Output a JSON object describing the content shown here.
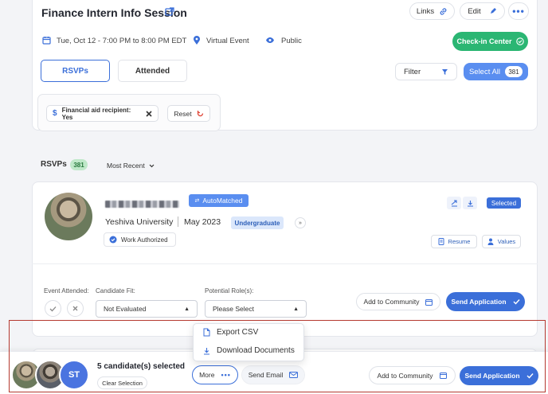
{
  "event": {
    "title": "Finance Intern Info Session",
    "date": "Tue, Oct 12 - 7:00 PM to 8:00 PM EDT",
    "location": "Virtual Event",
    "visibility": "Public",
    "links_label": "Links",
    "edit_label": "Edit",
    "checkin_label": "Check-in Center"
  },
  "tabs": {
    "rsvps": "RSVPs",
    "attended": "Attended"
  },
  "toolbar": {
    "filter_label": "Filter",
    "select_all_label": "Select All",
    "select_all_count": "381"
  },
  "filters": {
    "chip_label": "Financial aid recipient: Yes",
    "reset_label": "Reset"
  },
  "rsvps_section": {
    "title": "RSVPs",
    "count": "381",
    "sort_label": "Most Recent"
  },
  "candidate": {
    "match_badge": "AutoMatched",
    "school": "Yeshiva University",
    "grad_date": "May 2023",
    "level": "Undergraduate",
    "work_auth": "Work Authorized",
    "selected_label": "Selected",
    "resume_label": "Resume",
    "values_label": "Values",
    "event_attended_label": "Event Attended:",
    "fit_label": "Candidate Fit:",
    "fit_value": "Not Evaluated",
    "role_label": "Potential Role(s):",
    "role_placeholder": "Please Select",
    "add_community_label": "Add to Community",
    "send_application_label": "Send Application"
  },
  "dropdown": {
    "export_csv": "Export CSV",
    "download_documents": "Download Documents"
  },
  "bottom_bar": {
    "avatar_initials": "ST",
    "selected_text": "5 candidate(s) selected",
    "clear_label": "Clear Selection",
    "more_label": "More",
    "send_email_label": "Send Email",
    "add_community_label": "Add to Community",
    "send_application_label": "Send Application"
  },
  "colors": {
    "accent_blue": "#3b6fd9",
    "green": "#2bb673",
    "highlight_border": "#b5392f"
  }
}
